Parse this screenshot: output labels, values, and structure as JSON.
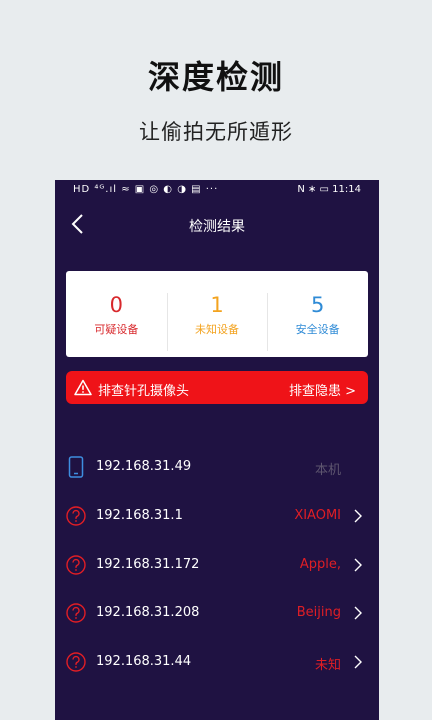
{
  "promo": {
    "title": "深度检测",
    "subtitle": "让偷拍无所遁形"
  },
  "status_bar": {
    "left_icons": "HD ⁴ᴳ.ıl ≈ ▣ ◎ ◐ ◑ ▤ ···",
    "right_text": "N ∗ ▭ 11:14"
  },
  "nav": {
    "title": "检测结果",
    "back_icon": "chevron-left-icon"
  },
  "summary": [
    {
      "count": "0",
      "label": "可疑设备",
      "color": "#d8282c"
    },
    {
      "count": "1",
      "label": "未知设备",
      "color": "#f3a31f"
    },
    {
      "count": "5",
      "label": "安全设备",
      "color": "#2f8bd6"
    }
  ],
  "alert": {
    "icon": "warning-icon",
    "text": "排查针孔摄像头",
    "action": "排查隐患 >"
  },
  "devices": [
    {
      "ip": "192.168.31.49",
      "vendor": "本机",
      "icon": "phone-icon",
      "self": true
    },
    {
      "ip": "192.168.31.1",
      "vendor": "XIAOMI",
      "icon": "question-icon",
      "self": false
    },
    {
      "ip": "192.168.31.172",
      "vendor": "Apple,",
      "icon": "question-icon",
      "self": false
    },
    {
      "ip": "192.168.31.208",
      "vendor": "Beijing",
      "icon": "question-icon",
      "self": false
    },
    {
      "ip": "192.168.31.44",
      "vendor": "未知",
      "icon": "question-icon",
      "self": false
    }
  ]
}
